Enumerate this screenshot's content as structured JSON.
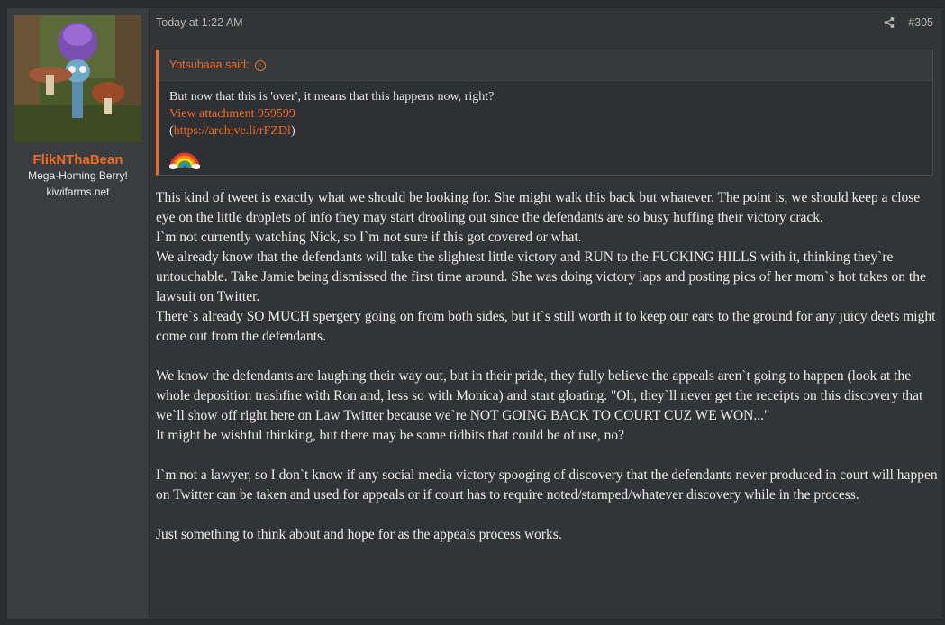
{
  "user": {
    "name": "FlikNThaBean",
    "title": "Mega-Homing Berry!",
    "banner": "kiwifarms.net",
    "avatar_icon": "avatar-image"
  },
  "post": {
    "timestamp": "Today at 1:22 AM",
    "number": "#305",
    "share_icon": "share-icon"
  },
  "quote": {
    "author": "Yotsubaaa said:",
    "line1": "But now that this is 'over', it means that this happens now, right?",
    "attachment": "View attachment 959599",
    "link_open": "(",
    "link": "https://archive.li/rFZDl",
    "link_close": ")",
    "emoji": "rainbow-icon"
  },
  "message": [
    "This kind of tweet is exactly what we should be looking for. She might walk this back but whatever. The point is, we should keep a close eye on the little droplets of info they may start drooling out since the defendants are so busy huffing their victory crack.",
    "I`m not currently watching Nick, so I`m not sure if this got covered or what.",
    "We already know that the defendants will take the slightest little victory and RUN to the FUCKING HILLS with it, thinking they`re untouchable. Take Jamie being dismissed the first time around. She was doing victory laps and posting pics of her mom`s hot takes on the lawsuit on Twitter.",
    "There`s already SO MUCH spergery going on from both sides, but it`s still worth it to keep our ears to the ground for any juicy deets might come out from the defendants.",
    "",
    "We know the defendants are laughing their way out, but in their pride, they fully believe the appeals aren`t going to happen (look at the whole deposition trashfire with Ron and, less so with Monica) and start gloating. \"Oh, they`ll never get the receipts on this discovery that we`ll show off right here on Law Twitter because we`re NOT GOING BACK TO COURT CUZ WE WON...\"",
    "It might be wishful thinking, but there may be some tidbits that could be of use, no?",
    "",
    "I`m not a lawyer, so I don`t know if any social media victory spooging of discovery that the defendants never produced in court will happen on Twitter can be taken and used for appeals or if court has to require noted/stamped/whatever discovery while in the process.",
    "",
    "Just something to think about and hope for as the appeals process works."
  ]
}
